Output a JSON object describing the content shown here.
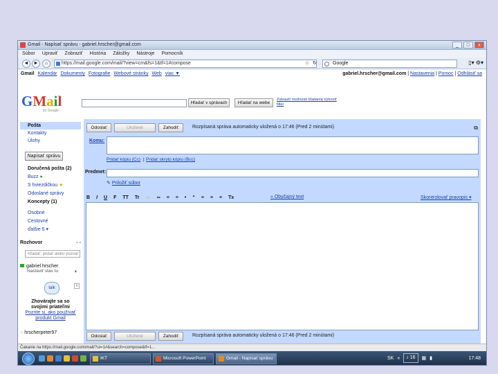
{
  "window": {
    "title": "Gmail - Napísať správu - gabriel.hrscher@gmail.com",
    "min": "_",
    "max": "□",
    "close": "x"
  },
  "menu": [
    "Súbor",
    "Upraviť",
    "Zobraziť",
    "História",
    "Záložky",
    "Nástroje",
    "Pomocník"
  ],
  "nav": {
    "back": "◄",
    "forward": "►",
    "bookmark_icon": "star-icon",
    "url": "https://mail.google.com/mail/?view=cm&fs=1&tf=1#compose",
    "search_placeholder": "Google"
  },
  "gbar": {
    "links": [
      "Gmail",
      "Kalendár",
      "Dokumenty",
      "Fotografie",
      "Webové stránky",
      "Web",
      "viac ▼"
    ],
    "user": "gabriel.hrscher@gmail.com",
    "settings": "Nastavenia",
    "help": "Pomoc",
    "signout": "Odhlásiť sa"
  },
  "logo": {
    "brand": "Gmail",
    "sub": "by Google"
  },
  "search": {
    "mail_button": "Hľadať v správach",
    "web_button": "Hľadať na webe",
    "options": "Zobraziť možnosti hľadania Vytvoriť filter"
  },
  "sidebar": {
    "compose": "Napísať správu",
    "mail": "Pošta",
    "contacts": "Kontakty",
    "tasks": "Úlohy",
    "inbox": "Doručená pošta (2)",
    "buzz": "Buzz",
    "starred": "S hviezdičkou",
    "sent": "Odoslané správy",
    "drafts": "Koncepty (1)",
    "personal": "Osobné",
    "travel": "Cestovné",
    "more": "ďalšie 5 ▾"
  },
  "chat": {
    "heading": "Rozhovor",
    "search_placeholder": "Hľadať, pridať alebo pozvať",
    "me": "gabriel hrscher",
    "status": "Nastaviť stav tu",
    "talk_label": "talk",
    "promo_line1": "Zhovárajte sa so",
    "promo_line2": "svojimi priateľmi",
    "promo_link": "Pozrite si, ako používať produkt Gmail",
    "contact2": "hrscherpeter97"
  },
  "compose": {
    "send": "Odoslať",
    "save": "Uložené",
    "discard": "Zahodiť",
    "autosave_msg": "Rozpísaná správa automaticky uložená o 17:46 (Pred 2 minútami)",
    "to_label": "Komu:",
    "add_cc": "Pridať kópiu (Cc)",
    "separator": "|",
    "add_bcc": "Pridať skrytú kópiu (Bcc)",
    "subject_label": "Predmet:",
    "attach": "Priložiť súbor",
    "plain_text": "« Obyčajný text",
    "spellcheck": "Skontrolovať pravopis ▾"
  },
  "format_toolbar": [
    "B",
    "I",
    "U",
    "F",
    "TT",
    "Tr",
    "☺",
    "∞",
    "≡",
    "≡",
    "•",
    "“",
    "≡",
    "≡",
    "≡",
    "Tx"
  ],
  "statusbar": "Čakanie na https://mail.google.com/mail/?ui=1#&search=compose&tf=1...",
  "taskbar": {
    "tasks": [
      "IKT",
      "Microsoft PowerPoint",
      "Gmail - Napísať správu"
    ],
    "lang": "SK",
    "clock": "17:48",
    "volume": "16"
  },
  "colors": {
    "panel": "#c3d9ff",
    "link": "#1a3e9e",
    "background": "#d8d8ee"
  }
}
